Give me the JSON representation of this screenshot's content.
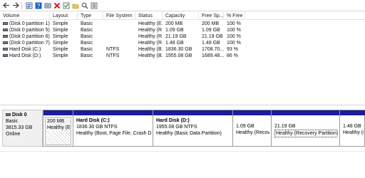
{
  "toolbar": {
    "buttons": [
      {
        "icon": "back-arrow-icon"
      },
      {
        "icon": "forward-arrow-icon"
      },
      {
        "icon": "properties-icon"
      },
      {
        "icon": "help-icon"
      },
      {
        "icon": "connect-icon"
      },
      {
        "icon": "delete-icon"
      },
      {
        "icon": "check-icon"
      },
      {
        "icon": "open-icon"
      },
      {
        "icon": "search-icon"
      },
      {
        "icon": "list-view-icon"
      }
    ]
  },
  "volume_table": {
    "headers": [
      "Volume",
      "Layout",
      "Type",
      "File System",
      "Status",
      "Capacity",
      "Free Sp...",
      "% Free"
    ],
    "rows": [
      {
        "volume": "(Disk 0 partition 1)",
        "layout": "Simple",
        "type": "Basic",
        "fs": "",
        "status": "Healthy (E...",
        "capacity": "200 MB",
        "free": "200 MB",
        "pct": "100 %",
        "icon": "gray"
      },
      {
        "volume": "(Disk 0 partition 5)",
        "layout": "Simple",
        "type": "Basic",
        "fs": "",
        "status": "Healthy (R...",
        "capacity": "1.09 GB",
        "free": "1.09 GB",
        "pct": "100 %",
        "icon": "gray"
      },
      {
        "volume": "(Disk 0 partition 6)",
        "layout": "Simple",
        "type": "Basic",
        "fs": "",
        "status": "Healthy (R...",
        "capacity": "21.19 GB",
        "free": "21.19 GB",
        "pct": "100 %",
        "icon": "gray"
      },
      {
        "volume": "(Disk 0 partition 7)",
        "layout": "Simple",
        "type": "Basic",
        "fs": "",
        "status": "Healthy (R...",
        "capacity": "1.48 GB",
        "free": "1.48 GB",
        "pct": "100 %",
        "icon": "gray"
      },
      {
        "volume": "Hard Disk (C:)",
        "layout": "Simple",
        "type": "Basic",
        "fs": "NTFS",
        "status": "Healthy (B...",
        "capacity": "1836.30 GB",
        "free": "1708.70...",
        "pct": "93 %",
        "icon": "gray"
      },
      {
        "volume": "Hard Disk (D:)",
        "layout": "Simple",
        "type": "Basic",
        "fs": "NTFS",
        "status": "Healthy (B...",
        "capacity": "1955.08 GB",
        "free": "1689.48...",
        "pct": "86 %",
        "icon": "gray"
      }
    ]
  },
  "disk": {
    "name": "Disk 0",
    "type": "Basic",
    "size": "3815.33 GB",
    "state": "Online",
    "partitions": [
      {
        "title": "",
        "line1": "200 MB",
        "line2": "Healthy (EFI",
        "hatch": true
      },
      {
        "title": "Hard Disk  (C:)",
        "line1": "1836.30 GB NTFS",
        "line2": "Healthy (Boot, Page File, Crash Dump,",
        "hatch": false
      },
      {
        "title": "Hard Disk  (D:)",
        "line1": "1955.08 GB NTFS",
        "line2": "Healthy (Basic Data Partition)",
        "hatch": false
      },
      {
        "title": "",
        "line1": "1.09 GB",
        "line2": "Healthy (Recover",
        "hatch": false
      },
      {
        "title": "",
        "line1": "21.19 GB",
        "line2": "Healthy (Recovery Partition)",
        "hatch": false,
        "selected": true
      },
      {
        "title": "",
        "line1": "1.48 GB",
        "line2": "Healthy (Recover",
        "hatch": false
      }
    ]
  },
  "colors": {
    "partition_bar": "#1c1c9c",
    "disk_label_bg": "#f0f0f0"
  }
}
